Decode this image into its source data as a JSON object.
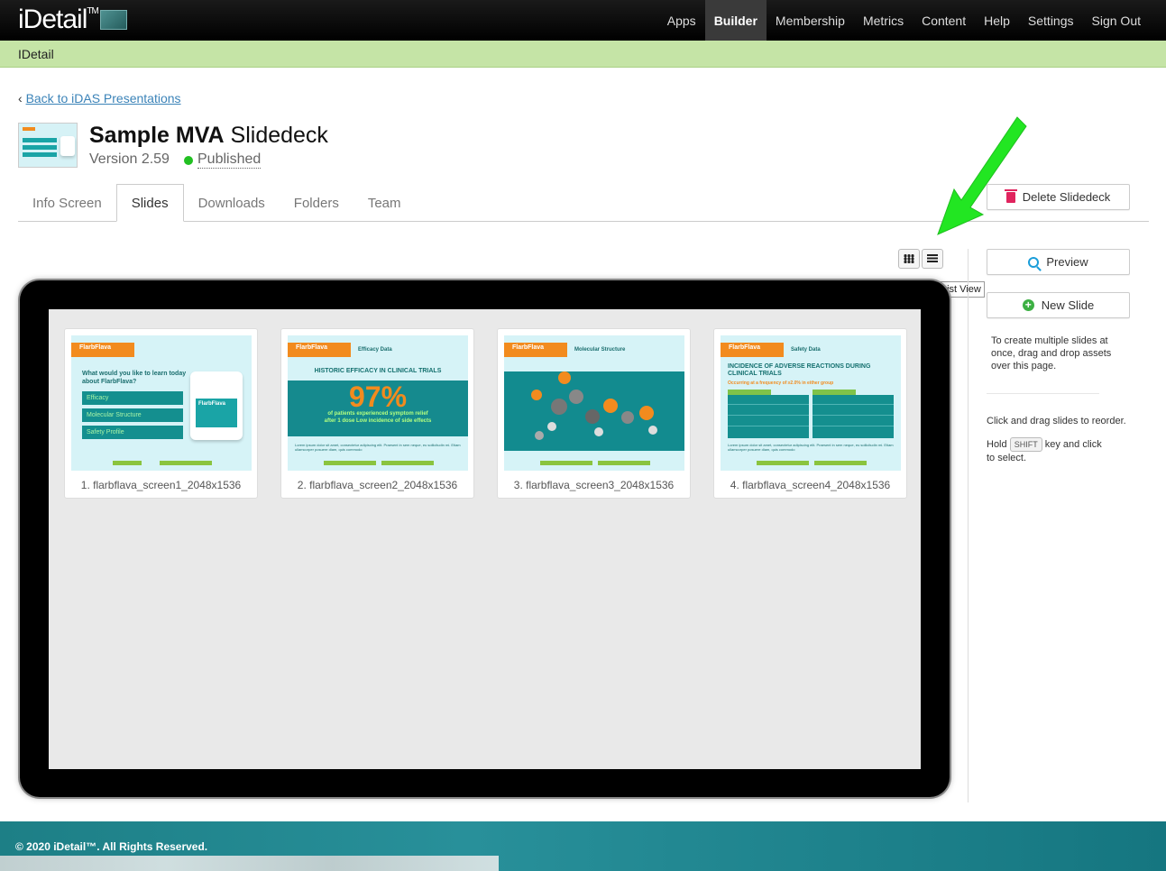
{
  "app": {
    "logo_text": "iDetail",
    "logo_tm": "TM"
  },
  "nav": {
    "items": [
      {
        "label": "Apps",
        "active": false
      },
      {
        "label": "Builder",
        "active": true
      },
      {
        "label": "Membership",
        "active": false
      },
      {
        "label": "Metrics",
        "active": false
      },
      {
        "label": "Content",
        "active": false
      },
      {
        "label": "Help",
        "active": false
      },
      {
        "label": "Settings",
        "active": false
      },
      {
        "label": "Sign Out",
        "active": false
      }
    ]
  },
  "subbar": {
    "label": "IDetail"
  },
  "back": {
    "chevron": "‹",
    "link": "Back to iDAS Presentations"
  },
  "deck": {
    "title_bold": "Sample MVA",
    "title_rest": "Slidedeck",
    "version": "Version 2.59",
    "status": "Published",
    "status_color": "#22c022"
  },
  "tabs": [
    {
      "label": "Info Screen",
      "active": false
    },
    {
      "label": "Slides",
      "active": true
    },
    {
      "label": "Downloads",
      "active": false
    },
    {
      "label": "Folders",
      "active": false
    },
    {
      "label": "Team",
      "active": false
    }
  ],
  "actions": {
    "delete_label": "Delete Slidedeck",
    "preview_label": "Preview",
    "new_slide_label": "New Slide",
    "tooltip": "List View"
  },
  "sidebar": {
    "help1": "To create multiple slides at once, drag and drop assets over this page.",
    "help2": "Click and drag slides to reorder.",
    "help3_pre": "Hold",
    "help3_key": "SHIFT",
    "help3_post": "key and click",
    "help3_line2": "to select."
  },
  "slides": [
    {
      "caption": "1. flarbflava_screen1_2048x1536",
      "brand": "FlarbFlava",
      "question": "What would you like to learn today about FlarbFlava?",
      "pills": [
        "Efficacy",
        "Molecular Structure",
        "Safety Profile"
      ],
      "jar_label": "FlarbFlava"
    },
    {
      "caption": "2. flarbflava_screen2_2048x1536",
      "brand": "FlarbFlava",
      "section": "Efficacy Data",
      "headline": "HISTORIC EFFICACY IN CLINICAL TRIALS",
      "big": "97%",
      "sub": "of patients experienced symptom relief after 1 dose Low incidence of side effects",
      "lorem": "Lorem ipsum dolor sit amet, consectetur adipiscing elit. Praesent in sem neque, eu sollicitudin mi. Etiam ullamcorper posuere diam, quis commodo"
    },
    {
      "caption": "3. flarbflava_screen3_2048x1536",
      "brand": "FlarbFlava",
      "section": "Molecular Structure"
    },
    {
      "caption": "4. flarbflava_screen4_2048x1536",
      "brand": "FlarbFlava",
      "section": "Safety Data",
      "headline": "INCIDENCE OF ADVERSE REACTIONS DURING CLINICAL TRIALS",
      "subhead": "Occurring at a frequency of ≥2.0% in either group",
      "lorem": "Lorem ipsum dolor sit amet, consectetur adipiscing elit. Praesent in sem neque, eu sollicitudin mi. Etiam ullamcorper posuere diam, quis commodo"
    }
  ],
  "footer": {
    "copyright": "© 2020 iDetail™.  All Rights Reserved."
  },
  "colors": {
    "accent_green_bar": "#c5e4a6",
    "link_blue": "#3b83b8",
    "orange": "#f28b1e",
    "teal": "#158a8e",
    "arrow_green": "#22e622"
  }
}
